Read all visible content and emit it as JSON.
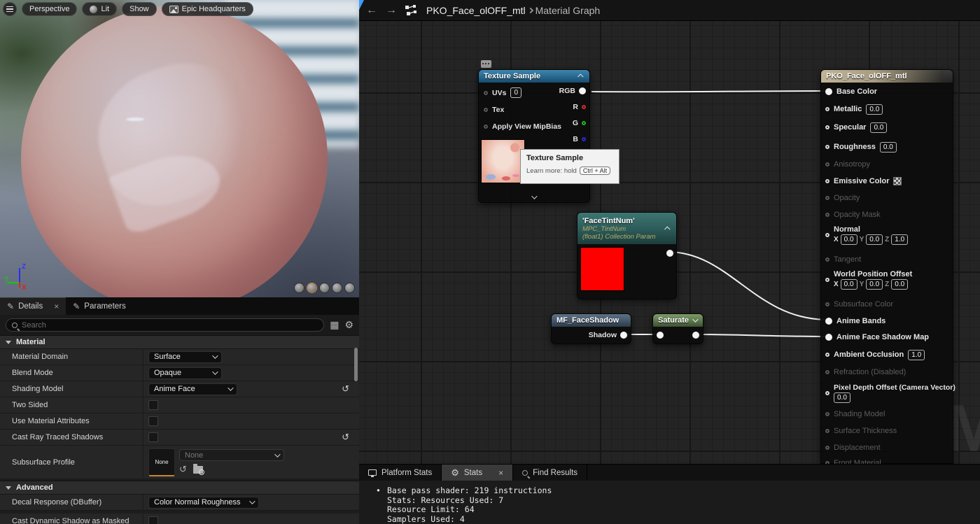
{
  "viewport": {
    "toolbar": {
      "perspective": "Perspective",
      "lit": "Lit",
      "show": "Show",
      "preview_scene": "Epic Headquarters"
    },
    "gizmo": {
      "x": "X",
      "y": "Y",
      "z": "Z"
    },
    "colors": {
      "sphere": "#bb7d77",
      "sphere_shadow_pattern": "#e4dce2",
      "ground": "#7b8494"
    }
  },
  "details_panel": {
    "tabs": [
      {
        "label": "Details"
      },
      {
        "label": "Parameters"
      }
    ],
    "close_icon": "×",
    "search": {
      "placeholder": "Search"
    },
    "material_section": {
      "title": "Material",
      "rows": [
        {
          "label": "Material Domain",
          "value": "Surface"
        },
        {
          "label": "Blend Mode",
          "value": "Opaque"
        },
        {
          "label": "Shading Model",
          "value": "Anime Face"
        },
        {
          "label": "Two Sided"
        },
        {
          "label": "Use Material Attributes"
        },
        {
          "label": "Cast Ray Traced Shadows"
        },
        {
          "label": "Subsurface Profile",
          "value": "None",
          "thumb_label": "None"
        }
      ]
    },
    "advanced_section": {
      "title": "Advanced",
      "rows": [
        {
          "label": "Decal Response (DBuffer)",
          "value": "Color Normal Roughness"
        },
        {
          "label": "Cast Dynamic Shadow as Masked"
        }
      ]
    },
    "reset_icon": "↺"
  },
  "header_bar": {
    "back_icon": "←",
    "forward_icon": "→",
    "breadcrumb_asset": "PKO_Face_olOFF_mtl",
    "breadcrumb_page": "Material Graph"
  },
  "graph": {
    "watermark": "M",
    "wire_color": "#f0f0f0",
    "tooltip": {
      "title": "Texture Sample",
      "hint": "Learn more: hold",
      "keycap": "Ctrl + Alt"
    },
    "nodes": {
      "texture_sample": {
        "title": "Texture Sample",
        "header_color": "#2b6d95",
        "inputs": [
          {
            "label": "UVs",
            "value": "0"
          },
          {
            "label": "Tex"
          },
          {
            "label": "Apply View MipBias"
          }
        ],
        "outputs": [
          {
            "label": "RGB",
            "color": "#f4f4f4"
          },
          {
            "label": "R",
            "color": "#d42a2a"
          },
          {
            "label": "G",
            "color": "#23b523"
          },
          {
            "label": "B",
            "color": "#2a2ad4"
          }
        ]
      },
      "face_tint": {
        "title": "'FaceTintNum'",
        "subtitle1": "MPC_TintNum",
        "subtitle2": "(float1) Collection Param",
        "header_color": "#2c5a58",
        "swatch_color": "#fe0000"
      },
      "mf_face_shadow": {
        "title": "MF_FaceShadow",
        "output": "Shadow",
        "header_color": "#46586c"
      },
      "saturate": {
        "title": "Saturate",
        "header_color": "#5e7a4e"
      },
      "main": {
        "title": "PKO_Face_olOFF_mtl",
        "header_color": "#b1a588",
        "axis": {
          "x": "X",
          "y": "Y",
          "z": "Z"
        },
        "pins": [
          {
            "label": "Base Color",
            "state": "connected"
          },
          {
            "label": "Metallic",
            "state": "open",
            "value": "0.0"
          },
          {
            "label": "Specular",
            "state": "open",
            "value": "0.0"
          },
          {
            "label": "Roughness",
            "state": "open",
            "value": "0.0"
          },
          {
            "label": "Anisotropy",
            "state": "disabled"
          },
          {
            "label": "Emissive Color",
            "state": "open",
            "swatch": "checker"
          },
          {
            "label": "Opacity",
            "state": "disabled"
          },
          {
            "label": "Opacity Mask",
            "state": "disabled"
          },
          {
            "label": "Normal",
            "state": "open",
            "x": "0.0",
            "y": "0.0",
            "z": "1.0"
          },
          {
            "label": "Tangent",
            "state": "disabled"
          },
          {
            "label": "World Position Offset",
            "state": "open",
            "x": "0.0",
            "y": "0.0",
            "z": "0.0"
          },
          {
            "label": "Subsurface Color",
            "state": "disabled"
          },
          {
            "label": "Anime Bands",
            "state": "connected"
          },
          {
            "label": "Anime Face Shadow Map",
            "state": "connected"
          },
          {
            "label": "Ambient Occlusion",
            "state": "open",
            "value": "1.0"
          },
          {
            "label": "Refraction (Disabled)",
            "state": "disabled"
          },
          {
            "label": "Pixel Depth Offset (Camera Vector)",
            "state": "open",
            "value": "0.0"
          },
          {
            "label": "Shading Model",
            "state": "disabled"
          },
          {
            "label": "Surface Thickness",
            "state": "disabled"
          },
          {
            "label": "Displacement",
            "state": "disabled"
          },
          {
            "label": "Front Material",
            "state": "disabled"
          }
        ]
      }
    }
  },
  "bottom_panel": {
    "tabs": [
      {
        "label": "Platform Stats"
      },
      {
        "label": "Stats"
      },
      {
        "label": "Find Results"
      }
    ],
    "close_icon": "×",
    "stats_lines": [
      "Base pass shader: 219 instructions",
      "Stats: Resources Used: 7",
      "Resource Limit: 64",
      "Samplers Used: 4"
    ]
  }
}
